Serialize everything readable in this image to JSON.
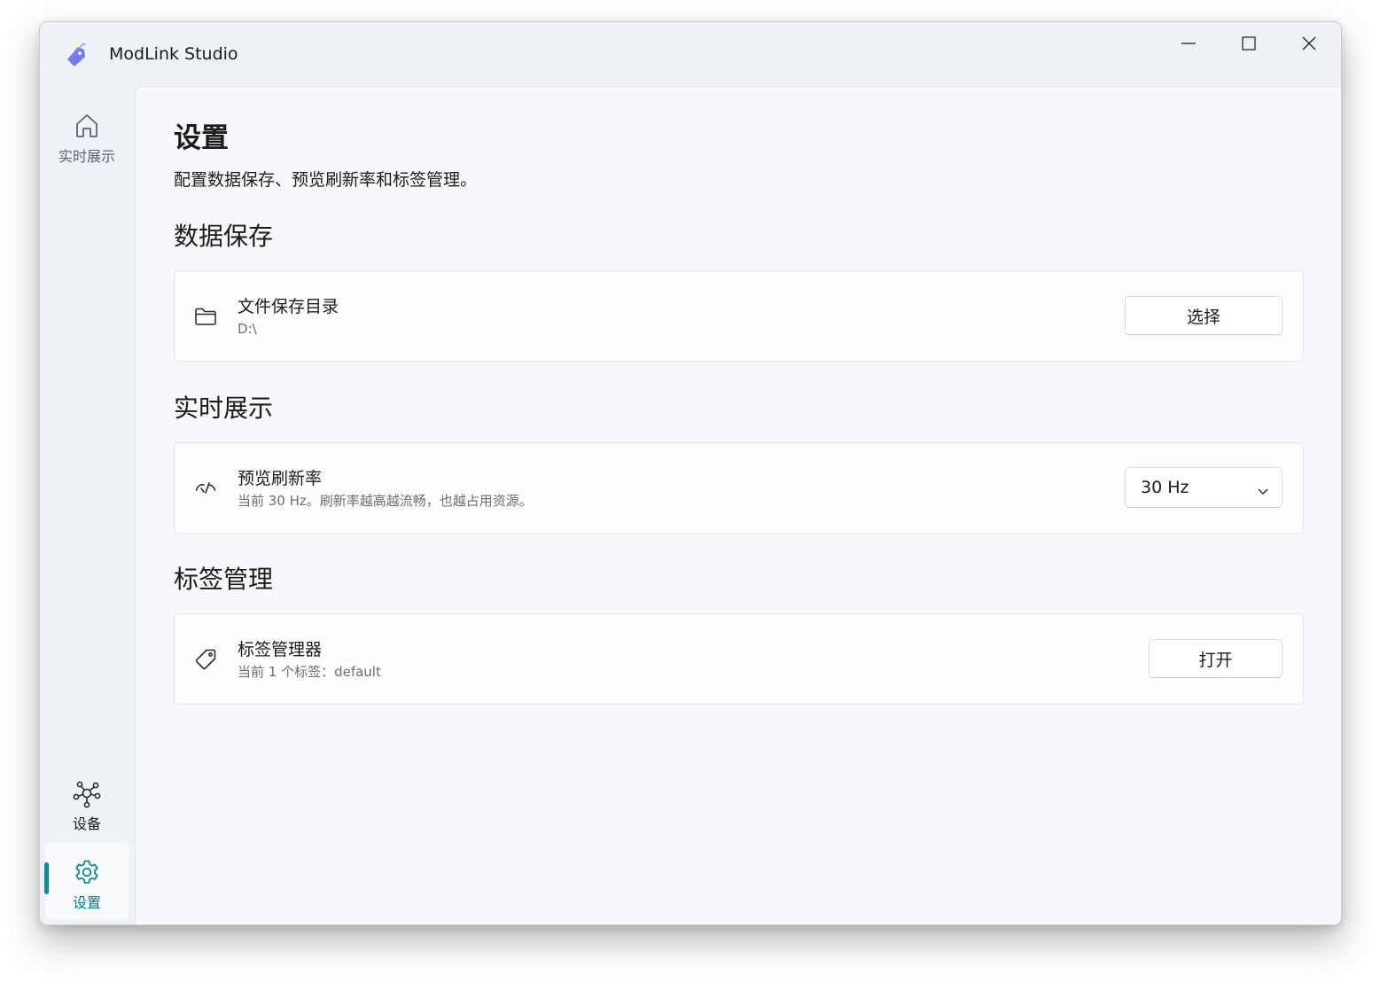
{
  "window": {
    "title": "ModLink Studio"
  },
  "sidebar": {
    "items": [
      {
        "label": "实时展示",
        "icon": "home-icon"
      },
      {
        "label": "设备",
        "icon": "network-icon"
      },
      {
        "label": "设置",
        "icon": "gear-icon",
        "selected": true
      }
    ]
  },
  "page": {
    "title": "设置",
    "subtitle": "配置数据保存、预览刷新率和标签管理。"
  },
  "sections": {
    "data_save": {
      "title": "数据保存",
      "card": {
        "title": "文件保存目录",
        "value": "D:\\",
        "button": "选择",
        "icon": "folder-icon"
      }
    },
    "live": {
      "title": "实时展示",
      "card": {
        "title": "预览刷新率",
        "desc": "当前 30 Hz。刷新率越高越流畅，也越占用资源。",
        "selected": "30 Hz",
        "icon": "gauge-icon"
      }
    },
    "tags": {
      "title": "标签管理",
      "card": {
        "title": "标签管理器",
        "desc": "当前 1 个标签：default",
        "button": "打开",
        "icon": "tag-icon"
      }
    }
  },
  "colors": {
    "accent": "#0f8a94",
    "accent_text": "#00808a"
  }
}
